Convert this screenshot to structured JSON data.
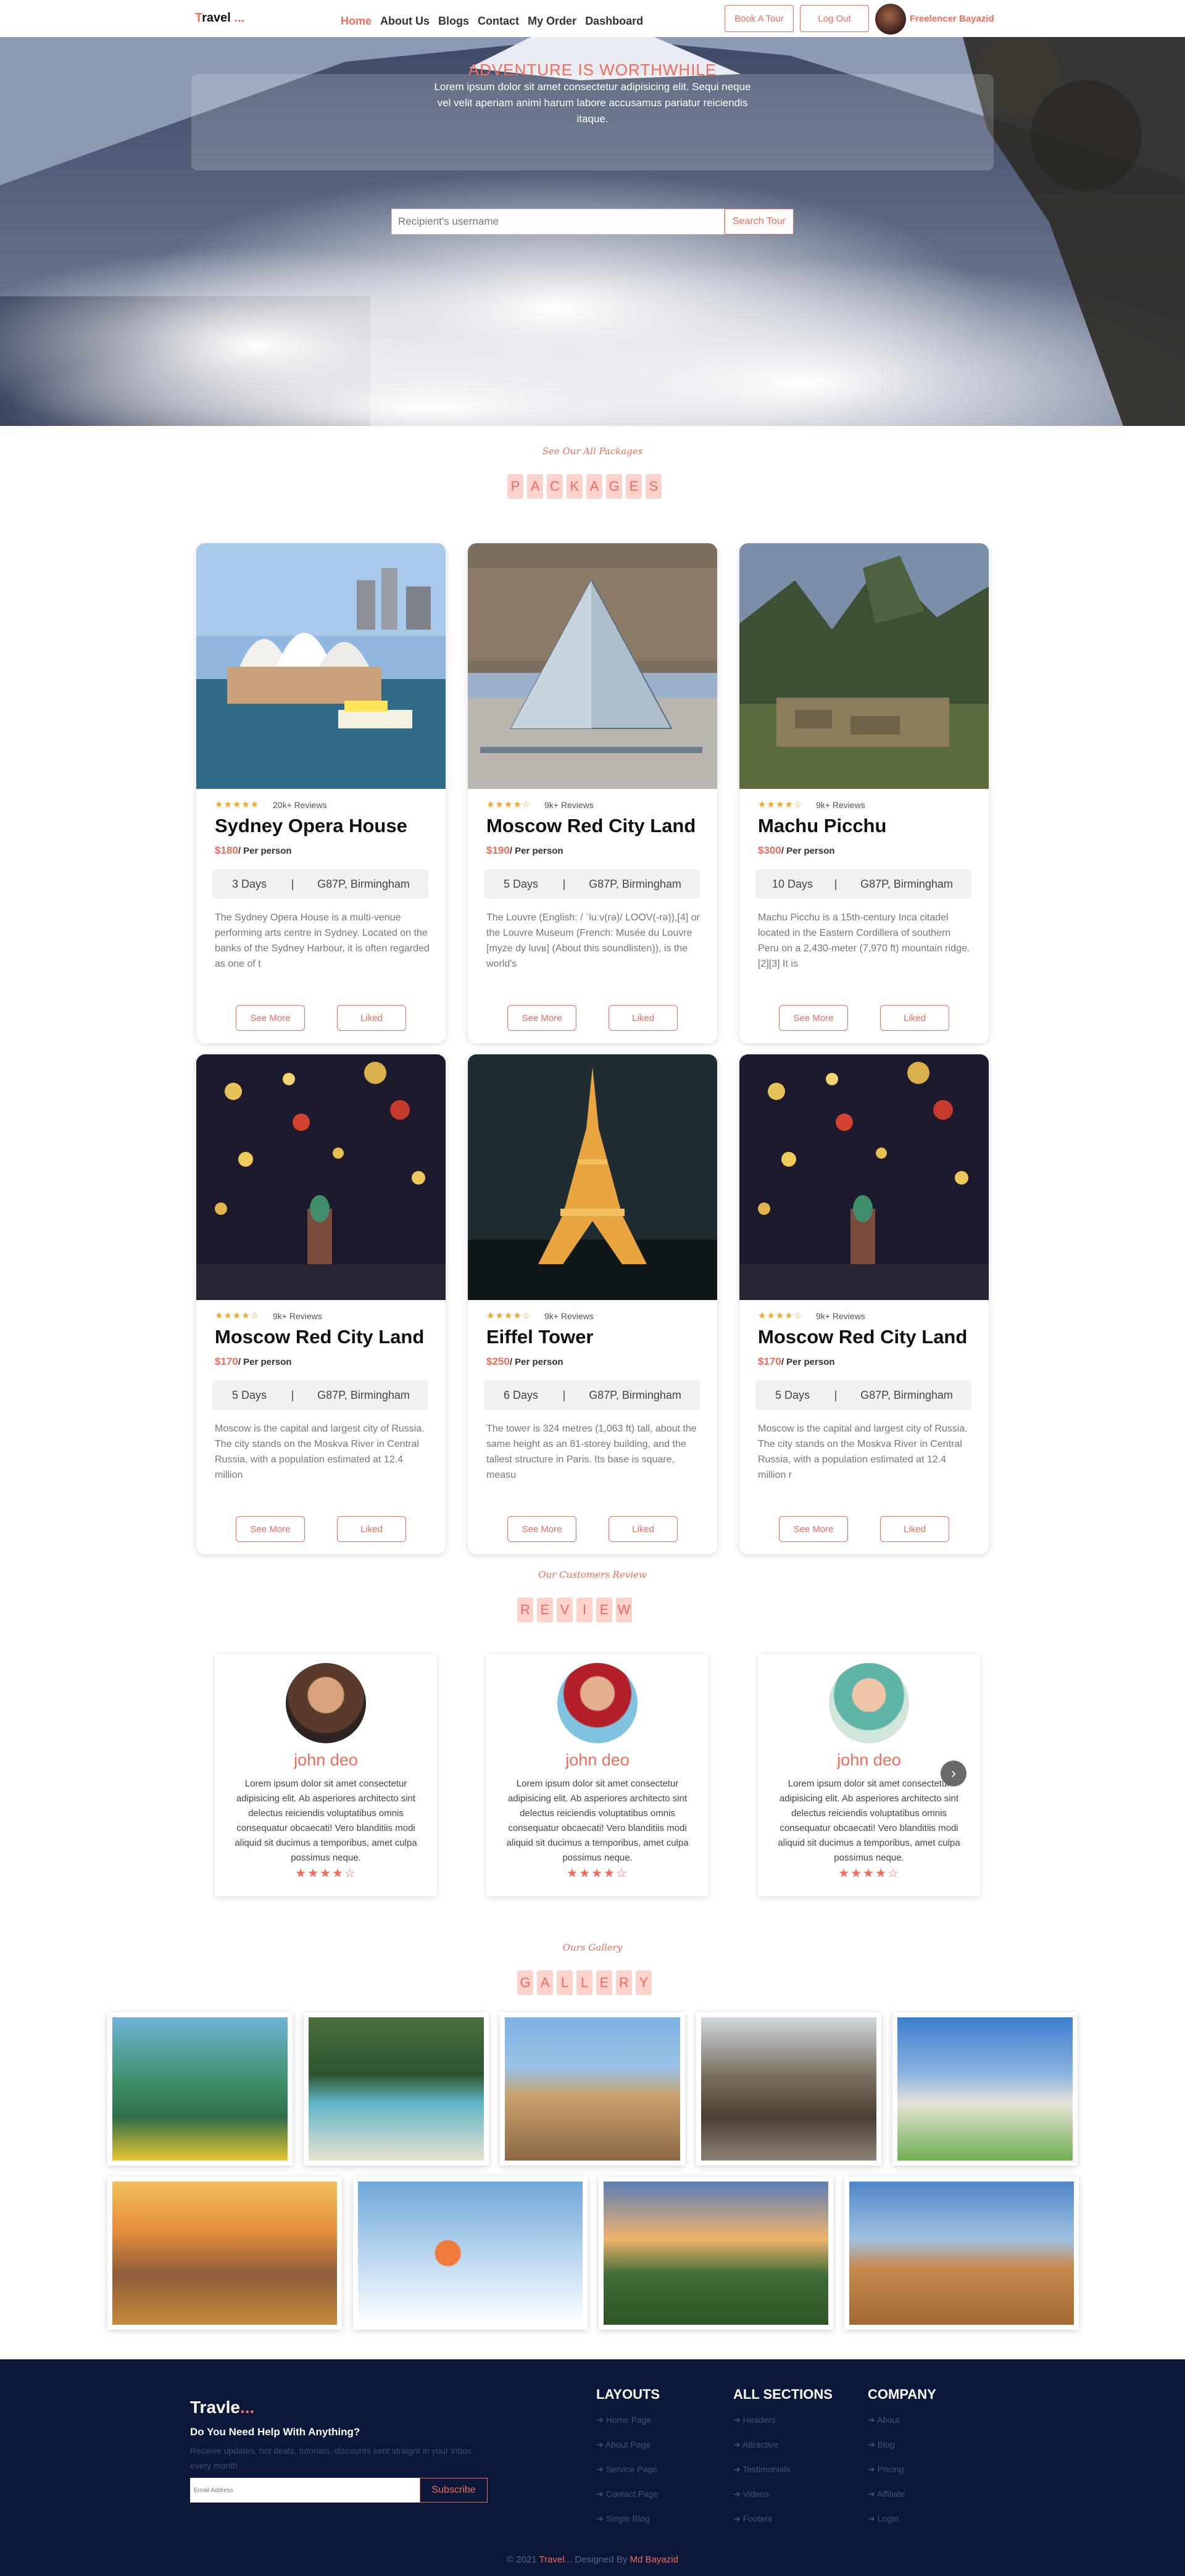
{
  "nav": {
    "logo_first": "T",
    "logo_rest": "ravel",
    "logo_dots": " ...",
    "links": [
      "Home",
      "About Us",
      "Blogs",
      "Contact",
      "My Order",
      "Dashboard"
    ],
    "book_label": "Book A Tour",
    "logout_label": "Log Out",
    "user_name": "Freelencer Bayazid"
  },
  "hero": {
    "title": "ADVENTURE IS WORTHWHILE",
    "subtitle": "Lorem ipsum dolor sit amet consectetur adipisicing elit. Sequi neque vel velit aperiam animi harum labore accusamus pariatur reiciendis itaque.",
    "search_placeholder": "Recipient's username",
    "search_button": "Search Tour"
  },
  "packages": {
    "kicker": "See Our All Packages",
    "letters": [
      "P",
      "A",
      "C",
      "K",
      "A",
      "G",
      "E",
      "S"
    ],
    "see_more": "See More",
    "liked": "Liked",
    "cards": [
      {
        "title": "Sydney Opera House",
        "stars": "★★★★★",
        "reviews": "20k+ Reviews",
        "price": "$180",
        "per": "/ Per person",
        "days": "3 Days",
        "location": "G87P, Birmingham",
        "desc": "The Sydney Opera House is a multi-venue performing arts centre in Sydney. Located on the banks of the Sydney Harbour, it is often regarded as one of t"
      },
      {
        "title": "Moscow Red City Land",
        "stars": "★★★★☆",
        "reviews": "9k+ Reviews",
        "price": "$190",
        "per": "/ Per person",
        "days": "5 Days",
        "location": "G87P, Birmingham",
        "desc": "The Louvre (English: / ˈluːv(rə)/ LOOV(-rə)),[4] or the Louvre Museum (French: Musée du Louvre [myze dy luvʁ] (About this soundlisten)), is the world's"
      },
      {
        "title": "Machu Picchu",
        "stars": "★★★★☆",
        "reviews": "9k+ Reviews",
        "price": "$300",
        "per": "/ Per person",
        "days": "10 Days",
        "location": "G87P, Birmingham",
        "desc": "Machu Picchu is a 15th-century Inca citadel located in the Eastern Cordillera of southern Peru on a 2,430-meter (7,970 ft) mountain ridge.[2][3] It is"
      },
      {
        "title": "Moscow Red City Land",
        "stars": "★★★★☆",
        "reviews": "9k+ Reviews",
        "price": "$170",
        "per": "/ Per person",
        "days": "5 Days",
        "location": "G87P, Birmingham",
        "desc": "Moscow is the capital and largest city of Russia. The city stands on the Moskva River in Central Russia, with a population estimated at 12.4 million"
      },
      {
        "title": "Eiffel Tower",
        "stars": "★★★★☆",
        "reviews": "9k+ Reviews",
        "price": "$250",
        "per": "/ Per person",
        "days": "6 Days",
        "location": "G87P, Birmingham",
        "desc": "The tower is 324 metres (1,063 ft) tall, about the same height as an 81-storey building, and the tallest structure in Paris. Its base is square, measu"
      },
      {
        "title": "Moscow Red City Land",
        "stars": "★★★★☆",
        "reviews": "9k+ Reviews",
        "price": "$170",
        "per": "/ Per person",
        "days": "5 Days",
        "location": "G87P, Birmingham",
        "desc": "Moscow is the capital and largest city of Russia. The city stands on the Moskva River in Central Russia, with a population estimated at 12.4 million r"
      }
    ]
  },
  "reviews": {
    "kicker": "Our Customers Review",
    "letters": [
      "R",
      "E",
      "V",
      "I",
      "E",
      "W"
    ],
    "items": [
      {
        "name": "john deo",
        "text": "Lorem ipsum dolor sit amet consectetur adipisicing elit. Ab asperiores architecto sint delectus reiciendis voluptatibus omnis consequatur obcaecati! Vero blanditiis modi aliquid sit ducimus a temporibus, amet culpa possimus neque.",
        "stars": "★★★★☆"
      },
      {
        "name": "john deo",
        "text": "Lorem ipsum dolor sit amet consectetur adipisicing elit. Ab asperiores architecto sint delectus reiciendis voluptatibus omnis consequatur obcaecati! Vero blanditiis modi aliquid sit ducimus a temporibus, amet culpa possimus neque.",
        "stars": "★★★★☆"
      },
      {
        "name": "john deo",
        "text": "Lorem ipsum dolor sit amet consectetur adipisicing elit. Ab asperiores architecto sint delectus reiciendis voluptatibus omnis consequatur obcaecati! Vero blanditiis modi aliquid sit ducimus a temporibus, amet culpa possimus neque.",
        "stars": "★★★★☆"
      }
    ],
    "next_icon": "›"
  },
  "gallery": {
    "kicker": "Ours Gallery",
    "letters": [
      "G",
      "A",
      "L",
      "L",
      "E",
      "R",
      "Y"
    ]
  },
  "footer": {
    "brand": "Travle",
    "brand_dots": "...",
    "help": "Do You Need Help With Anything?",
    "note": "Receive updates, hot deals, tutorials, discounts sent straignt in your inbox every month",
    "email_placeholder": "Email Address",
    "subscribe": "Subscribe",
    "columns": [
      {
        "title": "LAYOUTS",
        "links": [
          "Home Page",
          "About Page",
          "Service Page",
          "Contact Page",
          "Single Blog"
        ]
      },
      {
        "title": "ALL SECTIONS",
        "links": [
          "Headers",
          "Attractive",
          "Testimonials",
          "Videos",
          "Footers"
        ]
      },
      {
        "title": "COMPANY",
        "links": [
          "About",
          "Blog",
          "Pricing",
          "Affiliate",
          "Login"
        ]
      }
    ],
    "copy_prefix": "© 2021 ",
    "copy_brand": "Travel",
    "copy_mid": "... Designed By ",
    "copy_author": "Md Bayazid"
  }
}
